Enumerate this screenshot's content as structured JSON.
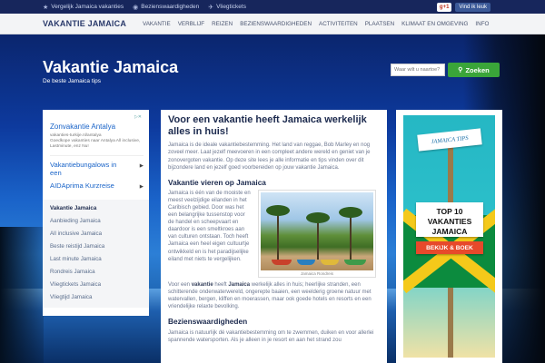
{
  "colors": {
    "topbar_bg": "#17265c",
    "nav_bg": "#f3f4f6",
    "brand": "#2a3a6b",
    "search_green": "#3aa539",
    "ad_link": "#1a64c8",
    "cta_red": "#e7492b",
    "heading": "#1c2a4e"
  },
  "topbar": {
    "links": [
      {
        "icon": "star-icon",
        "label": "Vergelijk Jamaica vakanties"
      },
      {
        "icon": "eye-icon",
        "label": "Bezienswaardigheden"
      },
      {
        "icon": "plane-icon",
        "label": "Vliegtickets"
      }
    ],
    "gplus_label": "g+1",
    "facebook_label": "Vind ik leuk"
  },
  "nav": {
    "brand": "VAKANTIE JAMAICA",
    "items": [
      "Vakantie",
      "Verblijf",
      "Reizen",
      "Bezienswaardigheden",
      "Activiteiten",
      "Plaatsen",
      "Klimaat en omgeving",
      "Info"
    ]
  },
  "hero": {
    "title": "Vakantie Jamaica",
    "subtitle": "De beste Jamaica tips",
    "search_placeholder": "Waar wilt u naartoe?",
    "search_button": "Zoeken"
  },
  "sidebar": {
    "ad": {
      "title": "Zonvakantie Antalya",
      "meta": "vakanties-turkije.nl/antalya\nGoedkope vakanties naar Antalya All inclusive, Lastminute, enz Nu!",
      "options": [
        "Vakantiebungalows in een",
        "AIDAprima Kurzreise"
      ]
    },
    "nav_items": [
      {
        "label": "Vakantie Jamaica",
        "active": true
      },
      {
        "label": "Aanbieding Jamaica",
        "active": false
      },
      {
        "label": "All inclusive Jamaica",
        "active": false
      },
      {
        "label": "Beste reistijd Jamaica",
        "active": false
      },
      {
        "label": "Last minute Jamaica",
        "active": false
      },
      {
        "label": "Rondreis Jamaica",
        "active": false
      },
      {
        "label": "Vliegtickets Jamaica",
        "active": false
      },
      {
        "label": "Vliegtijd Jamaica",
        "active": false
      }
    ]
  },
  "main": {
    "heading": "Voor een vakantie heeft Jamaica werkelijk alles in huis!",
    "intro": "Jamaica is de ideale vakantiebestemming. Het land van reggae, Bob Marley en nog zoveel meer. Laat jezelf meevoeren in een compleet andere wereld en geniet van je zonovergoten vakantie. Op deze site lees je alle informatie en tips vinden over dit bijzondere land en jezelf goed voorbereiden op jouw vakantie Jamaica.",
    "section1_title": "Vakantie vieren op Jamaica",
    "section1_text": "Jamaica is één van de mooiste en meest veelzijdige eilanden in het Caribisch gebied. Door was het een belangrijke tussenstop voor de handel en scheepvaart en daardoor is een smeltkroes aan van culturen ontstaan. Toch heeft Jamaica een heel eigen cultuurtje ontwikkeld en is het paradijselijke eiland met niets te vergelijken.",
    "photo_caption": "Jamaica Rondreis",
    "para2_prefix": "Voor een ",
    "para2_bold1": "vakantie",
    "para2_mid": " heeft ",
    "para2_bold2": "Jamaica",
    "para2_rest": " werkelijk alles in huis; heerlijke stranden, een schitterende onderwaterwereld, ongerepte baaien, een weelderig groene natuur met watervallen, bergen, kliffen en moerassen, maar ook goede hotels en resorts en een vriendelijke relaxte bevolking.",
    "section2_title": "Bezienswaardigheden",
    "section2_text": "Jamaica is natuurlijk dé vakantiebestemming om te zwemmen, duiken en voor allerlei spannende watersporten. Als je alleen in je resort en aan het strand zou"
  },
  "banner": {
    "sign_top": "JAMAICA TIPS",
    "sign_main": "TOP 10 VAKANTIES JAMAICA",
    "cta": "BEKIJK & BOEK"
  }
}
